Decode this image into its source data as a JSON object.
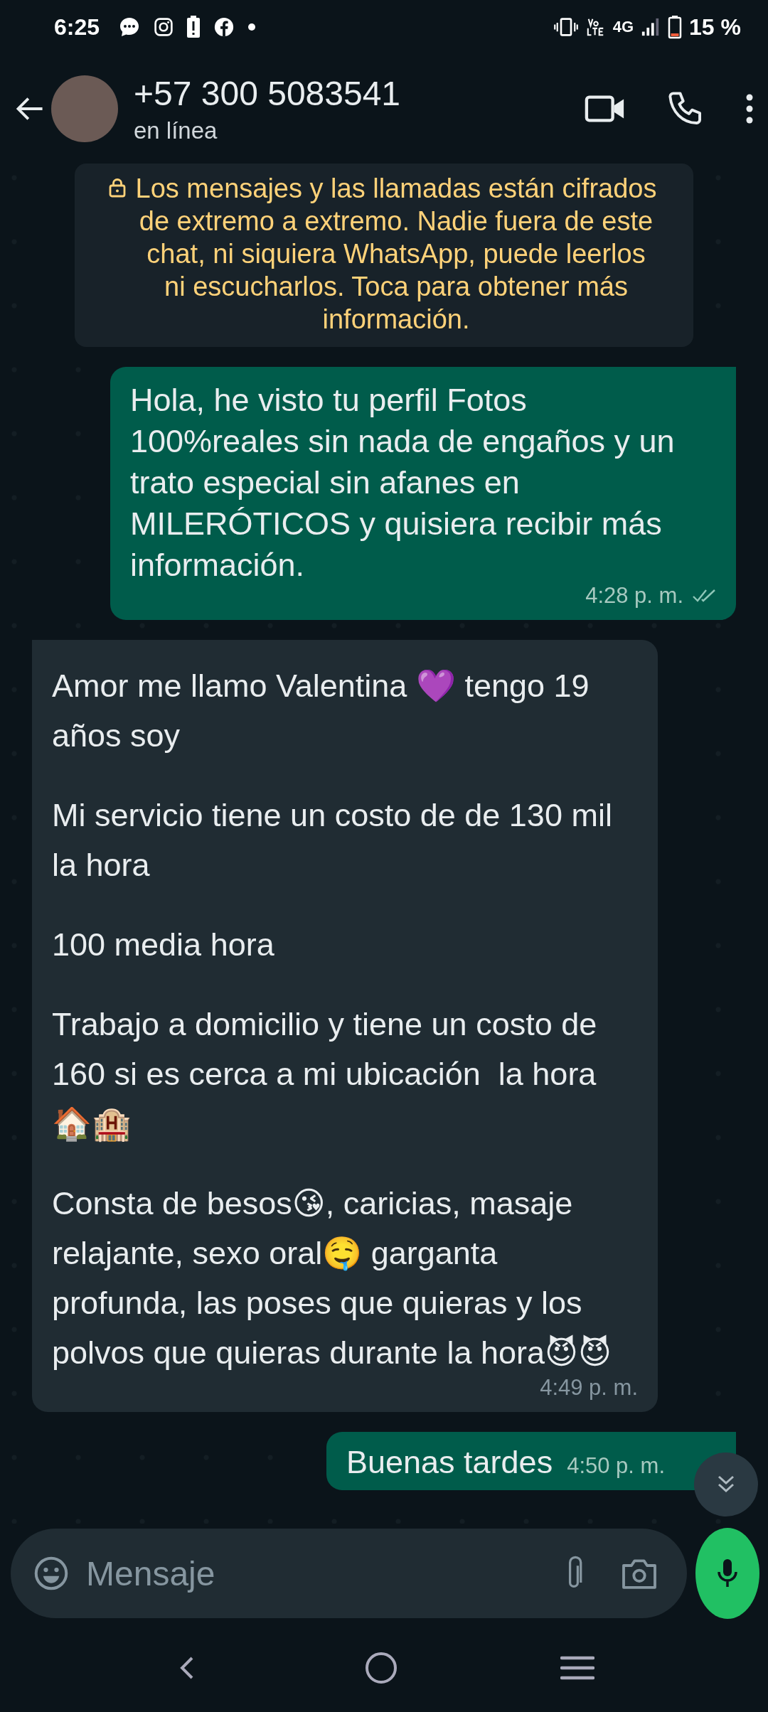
{
  "status_bar": {
    "time": "6:25",
    "battery": "15 %",
    "network": "4G"
  },
  "header": {
    "contact": "+57 300 5083541",
    "presence": "en línea"
  },
  "encryption_notice": "Los mensajes y las llamadas están cifrados de extremo a extremo. Nadie fuera de este chat, ni siquiera WhatsApp, puede leerlos ni escucharlos. Toca para obtener más información.",
  "messages": [
    {
      "kind": "sent",
      "paragraphs": [
        "Hola, he visto tu perfil Fotos 100%reales sin nada de engaños y un trato especial sin afanes en MILERÓTICOS y quisiera recibir más información."
      ],
      "time": "4:28 p. m.",
      "read": true
    },
    {
      "kind": "received",
      "paragraphs": [
        "Amor me llamo Valentina 💜 tengo 19 años soy",
        "Mi servicio tiene un costo de de 130 mil la hora",
        "100 media hora",
        "Trabajo a domicilio y tiene un costo de 160 si es cerca a mi ubicación  la hora 🏠🏨",
        "Consta de besos😘, caricias, masaje relajante, sexo oral🤤 garganta profunda, las poses que quieras y los polvos que quieras durante la hora😈😈"
      ],
      "time": "4:49 p. m."
    },
    {
      "kind": "sent",
      "paragraphs": [
        "Buenas tardes"
      ],
      "time": "4:50 p. m."
    }
  ],
  "composer": {
    "placeholder": "Mensaje"
  }
}
